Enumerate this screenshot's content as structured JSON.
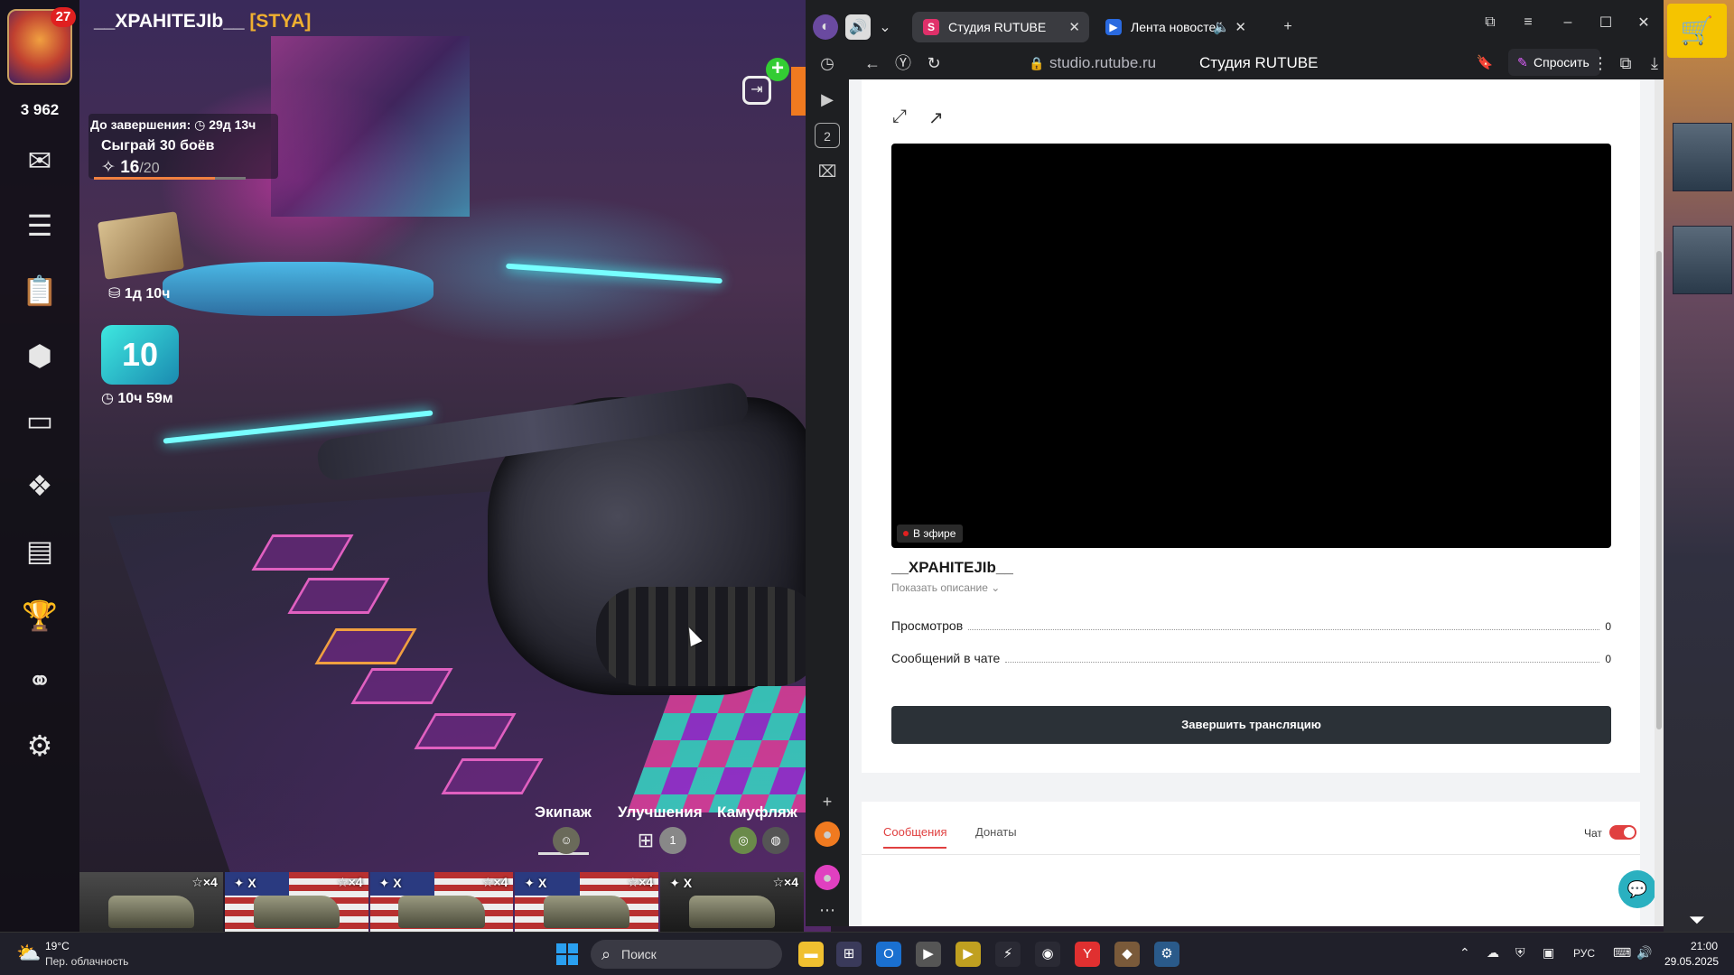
{
  "game": {
    "player_name": "__XPAHITEJIb__",
    "clan_tag": "[STYA]",
    "notifications": "27",
    "rating": "3 962",
    "mission": {
      "deadline_label": "До завершения:",
      "deadline_value": "29д 13ч",
      "title": "Сыграй 30 боёв",
      "progress_current": "16",
      "progress_total": "/20",
      "progress_fraction": 0.8
    },
    "book_timer": "1д 10ч",
    "level": "10",
    "level_timer": "10ч 59м",
    "tabs": {
      "crew": "Экипаж",
      "upgrades": "Улучшения",
      "camo": "Камуфляж"
    },
    "upgrade_count": "1",
    "carousel": [
      {
        "tier": "",
        "mult": "×4",
        "nation": "neutral"
      },
      {
        "tier": "X",
        "mult": "×4",
        "nation": "us"
      },
      {
        "tier": "X",
        "mult": "×4",
        "nation": "us"
      },
      {
        "tier": "X",
        "mult": "×4",
        "nation": "us"
      },
      {
        "tier": "X",
        "mult": "×4",
        "nation": "de"
      }
    ]
  },
  "browser": {
    "tabs": [
      {
        "label": "Студия RUTUBE",
        "icon": "S"
      },
      {
        "label": "Лента новостей",
        "icon": "▶"
      }
    ],
    "url": "studio.rutube.ru",
    "page_title": "Студия RUTUBE",
    "ask_label": "Спросить",
    "sidebar_badge": "2"
  },
  "studio": {
    "live_label": "В эфире",
    "stream_name": "__XPAHITEJIb__",
    "show_description": "Показать описание",
    "stats": [
      {
        "label": "Просмотров",
        "value": "0"
      },
      {
        "label": "Сообщений в чате",
        "value": "0"
      }
    ],
    "end_button": "Завершить трансляцию",
    "chat_tabs": [
      "Сообщения",
      "Донаты"
    ],
    "chat_toggle_label": "Чат",
    "chat_enabled": true
  },
  "taskbar": {
    "weather_temp": "19°C",
    "weather_desc": "Пер. облачность",
    "search_placeholder": "Поиск",
    "lang": "РУС",
    "time": "21:00",
    "date": "29.05.2025"
  },
  "colors": {
    "accent_red": "#e04040",
    "end_button_bg": "#2b3137",
    "clan_gold": "#f0b030"
  }
}
